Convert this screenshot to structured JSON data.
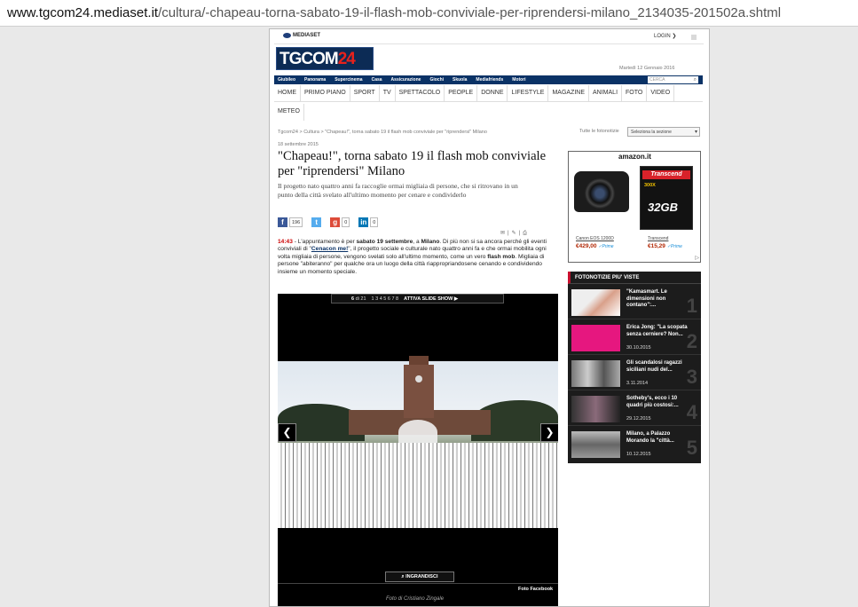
{
  "browser": {
    "url_domain": "www.tgcom24.mediaset.it",
    "url_path": "/cultura/-chapeau-torna-sabato-19-il-flash-mob-conviviale-per-riprendersi-milano_2134035-201502a.shtml"
  },
  "topbar": {
    "mediaset": "MEDIASET",
    "login": "LOGIN ❯"
  },
  "logo": {
    "tg": "TG",
    "com": "COM",
    "num": "24"
  },
  "date": "Martedì 12 Gennaio 2016",
  "bluebar": {
    "links": [
      "Giubileo",
      "Panorama",
      "Supercinema",
      "Casa",
      "Assicurazione",
      "Giochi",
      "Skuola",
      "Mediafriends",
      "Motori"
    ],
    "search_placeholder": "CERCA"
  },
  "nav": {
    "items": [
      "HOME",
      "PRIMO PIANO",
      "SPORT",
      "TV",
      "SPETTACOLO",
      "PEOPLE",
      "DONNE",
      "LIFESTYLE",
      "MAGAZINE",
      "ANIMALI",
      "FOTO",
      "VIDEO"
    ],
    "meteo": "METEO"
  },
  "breadcrumb": "Tgcom24 > Cultura > \"Chapeau!\", torna sabato 19 il flash mob conviviale per \"riprendersi\" Milano",
  "fotonotizie_label": "Tutte le fotonotizie",
  "section_select": "Seleziona la sezione",
  "article": {
    "date": "18 settembre 2015",
    "title": "\"Chapeau!\", torna sabato 19 il flash mob conviviale per \"riprendersi\" Milano",
    "subtitle": "Il progetto nato quattro anni fa raccoglie ormai migliaia di persone, che si ritrovano in un punto della città svelato all'ultimo momento per cenare e condividerlo",
    "time": "14:43",
    "body_p1": " - L'appuntamento è per ",
    "body_b1": "sabato 19 settembre",
    "body_p2": ", a ",
    "body_b2": "Milano",
    "body_p3": ". Di più non si sa ancora perché gli eventi conviviali di \"",
    "body_link": "Cenacon me!",
    "body_p4": "\", il progetto sociale e culturale nato quattro anni fa e che ormai mobilita ogni volta migliaia di persone, vengono svelati solo all'ultimo momento, come un vero ",
    "body_b3": "flash mob",
    "body_p5": ". Migliaia di persone \"abiteranno\" per qualche ora un luogo della città riappropriandosene cenando e condividendo insieme un momento speciale."
  },
  "social": {
    "fb_count": "196",
    "tw_count": "",
    "gp_count": "0",
    "in_count": "0"
  },
  "gallery": {
    "current": "6",
    "of": "di 21",
    "pages": "1 3 4 5 6 7 8",
    "slideshow": "ATTIVA SLIDE SHOW ▶",
    "prev": "❮",
    "next": "❯",
    "enlarge": "INGRANDISCI",
    "credit_fb": "Foto Facebook",
    "caption": "Foto di Cristiano Zingale"
  },
  "ad": {
    "brand": "amazon.it",
    "product1": "Canon EOS 1200D",
    "price1": "€429,00",
    "product2": "Transcend",
    "price2": "€15,29",
    "prime": "✓Prime",
    "brand_card": "Transcend",
    "card_speed": "300X",
    "card_size": "32GB"
  },
  "fotonotizie": {
    "header": "FOTONOTIZIE PIU' VISTE",
    "items": [
      {
        "title": "\"Kamasmart. Le dimensioni non contano\":...",
        "date": "",
        "num": "1"
      },
      {
        "title": "Erica Jong: \"La scopata senza cerniere? Non...",
        "date": "30.10.2015",
        "num": "2"
      },
      {
        "title": "Gli scandalosi ragazzi siciliani nudi del...",
        "date": "3.11.2014",
        "num": "3"
      },
      {
        "title": "Sotheby's, ecco i 10 quadri più costosi:...",
        "date": "29.12.2015",
        "num": "4"
      },
      {
        "title": "Milano, a Palazzo Morando la \"città...",
        "date": "10.12.2015",
        "num": "5"
      }
    ]
  },
  "colors": {
    "navy": "#0a3266",
    "red": "#c8102e",
    "dark": "#1c1c1c"
  }
}
